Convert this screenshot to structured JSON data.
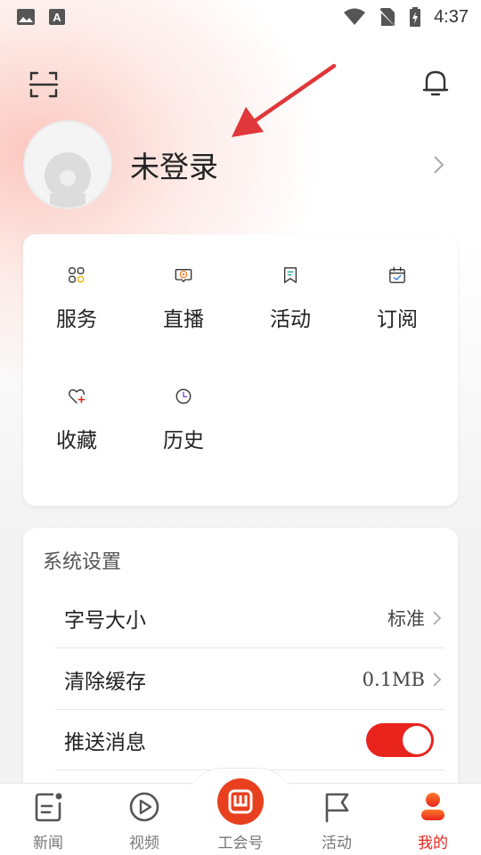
{
  "status_bar": {
    "time": "4:37"
  },
  "profile": {
    "name": "未登录"
  },
  "services": [
    {
      "label": "服务",
      "icon": "apps-grid-icon"
    },
    {
      "label": "直播",
      "icon": "live-tv-icon"
    },
    {
      "label": "活动",
      "icon": "bookmark-activity-icon"
    },
    {
      "label": "订阅",
      "icon": "calendar-check-icon"
    },
    {
      "label": "收藏",
      "icon": "heart-plus-icon"
    },
    {
      "label": "历史",
      "icon": "clock-history-icon"
    }
  ],
  "settings": {
    "title": "系统设置",
    "font_size": {
      "label": "字号大小",
      "value": "标准"
    },
    "cache": {
      "label": "清除缓存",
      "value": "0.1MB"
    },
    "push": {
      "label": "推送消息",
      "enabled": true
    }
  },
  "tabs": [
    {
      "label": "新闻",
      "icon": "news-icon"
    },
    {
      "label": "视频",
      "icon": "video-play-icon"
    },
    {
      "label": "工会号",
      "icon": "union-logo-icon"
    },
    {
      "label": "活动",
      "icon": "flag-icon"
    },
    {
      "label": "我的",
      "icon": "person-icon",
      "active": true
    }
  ],
  "colors": {
    "accent": "#e8241d",
    "center_button": "#e8401f"
  }
}
